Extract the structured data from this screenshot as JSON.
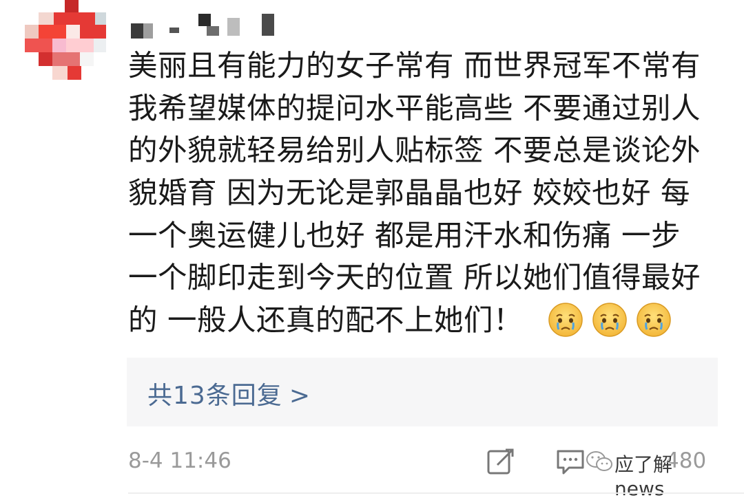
{
  "comment": {
    "lines": [
      "美丽且有能力的女子常有 而世界冠军不常有",
      "我希望媒体的提问水平能高些 不要通过别人",
      "的外貌就轻易给别人贴标签 不要总是谈论外",
      "貌婚育 因为无论是郭晶晶也好 姣姣也好 每",
      "一个奥运健儿也好 都是用汗水和伤痛 一步",
      "一个脚印走到今天的位置 所以她们值得最好",
      "的 一般人还真的配不上她们！"
    ],
    "emoji": [
      "crying-face-emoji",
      "crying-face-emoji",
      "crying-face-emoji"
    ]
  },
  "replies": {
    "label": "共13条回复",
    "chevron": ">"
  },
  "footer": {
    "timestamp": "8-4 11:46",
    "like_count": "480",
    "watermark": "应了解news"
  },
  "colors": {
    "reply_link": "#4b6a92",
    "reply_bg": "#f6f6f7",
    "meta_text": "#9a9a9a"
  }
}
